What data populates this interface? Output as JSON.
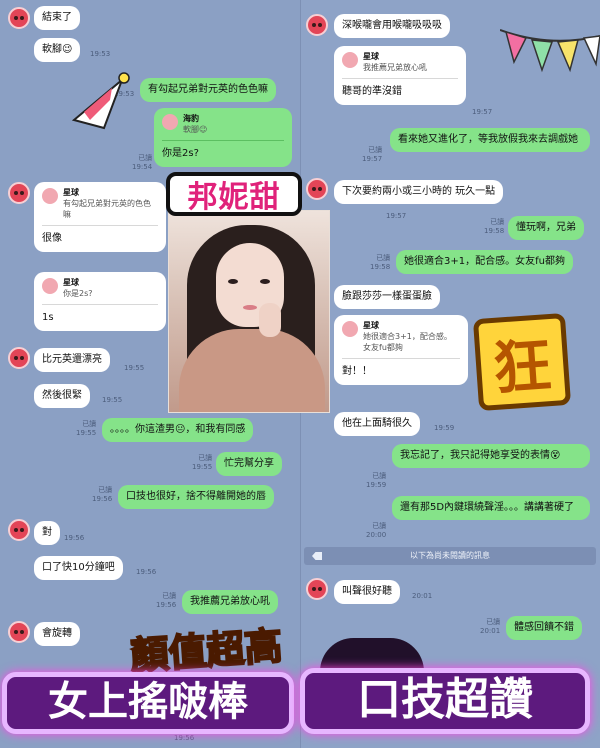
{
  "left_chat": [
    {
      "side": "in",
      "text": "結束了"
    },
    {
      "side": "in",
      "text": "軟腳😉",
      "time": "19:53"
    },
    {
      "side": "out",
      "text": "有勾起兄弟對元英的色色嘛",
      "time": "19:53"
    },
    {
      "side": "out_reply",
      "reply_name": "海豹",
      "reply_text": "軟腳😉",
      "text": "你是2s?",
      "read": "已讀",
      "time": "19:54"
    },
    {
      "side": "in_reply",
      "reply_name": "星球",
      "reply_text": "有勾起兄弟對元英的色色嘛",
      "text": "很像"
    },
    {
      "side": "in_reply",
      "reply_name": "星球",
      "reply_text": "你是2s?",
      "text": "1s"
    },
    {
      "side": "in",
      "text": "比元英還漂亮",
      "time": "19:55"
    },
    {
      "side": "in",
      "text": "然後很緊",
      "time": "19:55"
    },
    {
      "side": "out",
      "text": "。。。。你這渣男😐，和我有同感",
      "read": "已讀",
      "time": "19:55"
    },
    {
      "side": "out",
      "text": "忙完幫分享",
      "read": "已讀",
      "time": "19:55"
    },
    {
      "side": "out",
      "text": "口技也很好，捨不得離開她的唇",
      "read": "已讀",
      "time": "19:56"
    },
    {
      "side": "in",
      "text": "對",
      "time": "19:56"
    },
    {
      "side": "in",
      "text": "口了快10分鐘吧",
      "time": "19:56"
    },
    {
      "side": "out",
      "text": "我推薦兄弟放心吼",
      "read": "已讀",
      "time": "19:56"
    },
    {
      "side": "in",
      "text": "會旋轉",
      "time": "19:56"
    }
  ],
  "right_chat": [
    {
      "side": "in",
      "text": "深喉嚨會用喉嚨吸吸吸"
    },
    {
      "side": "in_reply",
      "reply_name": "星球",
      "reply_text": "我推薦兄弟放心吼",
      "text": "聽哥的準沒錯",
      "time": "19:57"
    },
    {
      "side": "out",
      "text": "看來她又進化了，等我放假我來去調戲她",
      "read": "已讀",
      "time": "19:57"
    },
    {
      "side": "in",
      "text": "下次要約兩小或三小時的 玩久一點",
      "time": "19:57"
    },
    {
      "side": "out",
      "text": "懂玩啊，兄弟",
      "read": "已讀",
      "time": "19:58"
    },
    {
      "side": "out",
      "text": "她很適合3+1，配合感。女友fu都夠",
      "read": "已讀",
      "time": "19:58"
    },
    {
      "side": "in",
      "text": "臉跟莎莎一樣蛋蛋臉"
    },
    {
      "side": "in_reply",
      "reply_name": "星球",
      "reply_text": "她很適合3+1，配合感。女友fu都夠",
      "text": "對！！"
    },
    {
      "side": "in",
      "text": "他在上面騎很久",
      "time": "19:59"
    },
    {
      "side": "out",
      "text": "我忘記了，我只記得她享受的表情😵",
      "read": "已讀",
      "time": "19:59"
    },
    {
      "side": "out",
      "text": "還有那5D內鍵環繞聲淫。。。講講著硬了",
      "read": "已讀",
      "time": "20:00"
    },
    {
      "side": "in",
      "text": "叫聲很好聽",
      "time": "20:01"
    },
    {
      "side": "out",
      "text": "體感回饋不錯",
      "read": "已讀",
      "time": "20:01"
    }
  ],
  "unread_divider": "以下為尚未閱讀的訊息",
  "overlays": {
    "name_tag": "邦妮甜",
    "kuang": "狂",
    "caption_1": "顏值超高",
    "caption_2": "女上搖啵棒",
    "caption_3": "口技超讚"
  },
  "colors": {
    "bg_left": "#8ba0c4",
    "bg_right": "#8ea3c7",
    "out_bubble": "#85e389",
    "in_bubble": "#ffffff",
    "avatar": "#e34557"
  }
}
